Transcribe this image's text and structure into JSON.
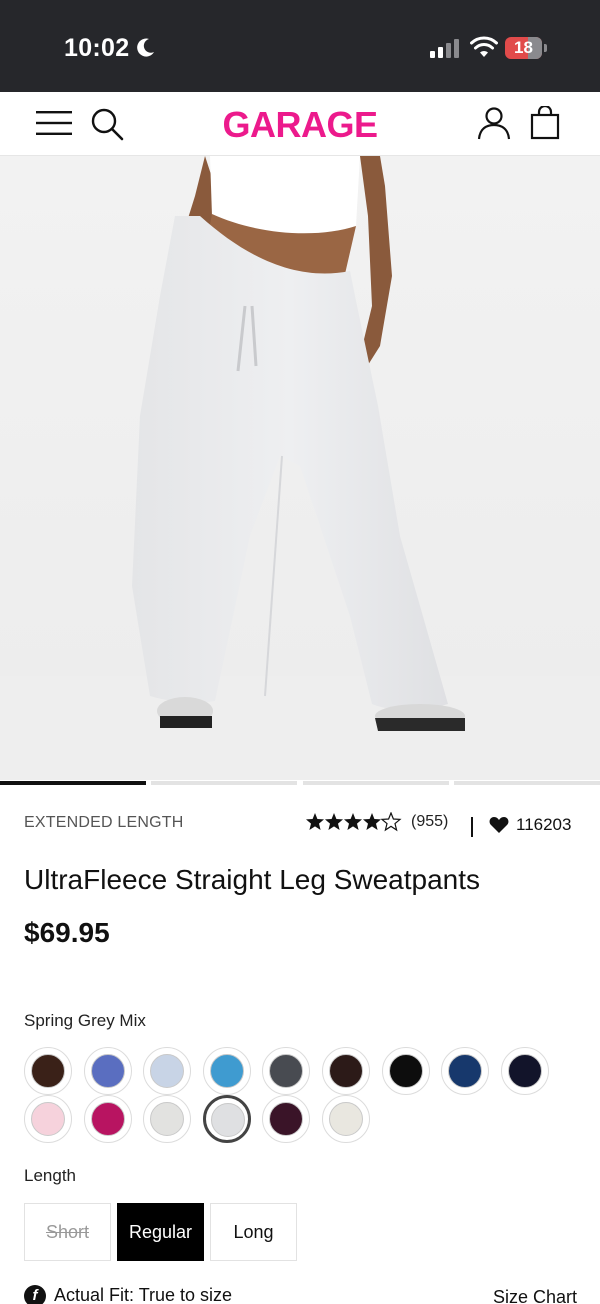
{
  "status_bar": {
    "time": "10:02",
    "battery": "18"
  },
  "header": {
    "logo": "GARAGE"
  },
  "carousel": {
    "active_index": 0,
    "count": 4
  },
  "product": {
    "tagline": "EXTENDED LENGTH",
    "rating": 4.5,
    "reviews": "(955)",
    "likes": "116203",
    "title": "UltraFleece Straight Leg Sweatpants",
    "price": "$69.95",
    "selected_color": "Spring Grey Mix",
    "swatches": [
      {
        "color": "#3a2118"
      },
      {
        "color": "#5a6ec0"
      },
      {
        "color": "#c8d4e6"
      },
      {
        "color": "#3f9bd0"
      },
      {
        "color": "#484b51"
      },
      {
        "color": "#2c1a18"
      },
      {
        "color": "#0d0d0d"
      },
      {
        "color": "#17386c"
      },
      {
        "color": "#12142a"
      },
      {
        "color": "#f6d2dc"
      },
      {
        "color": "#b81461"
      },
      {
        "color": "#e2e2e0"
      },
      {
        "color": "#dfe0e2"
      },
      {
        "color": "#3a1428"
      },
      {
        "color": "#e9e7e0"
      }
    ],
    "selected_swatch_index": 12,
    "length_label": "Length",
    "lengths": [
      "Short",
      "Regular",
      "Long"
    ],
    "fit_text": "Actual Fit: True to size",
    "size_chart": "Size Chart"
  }
}
